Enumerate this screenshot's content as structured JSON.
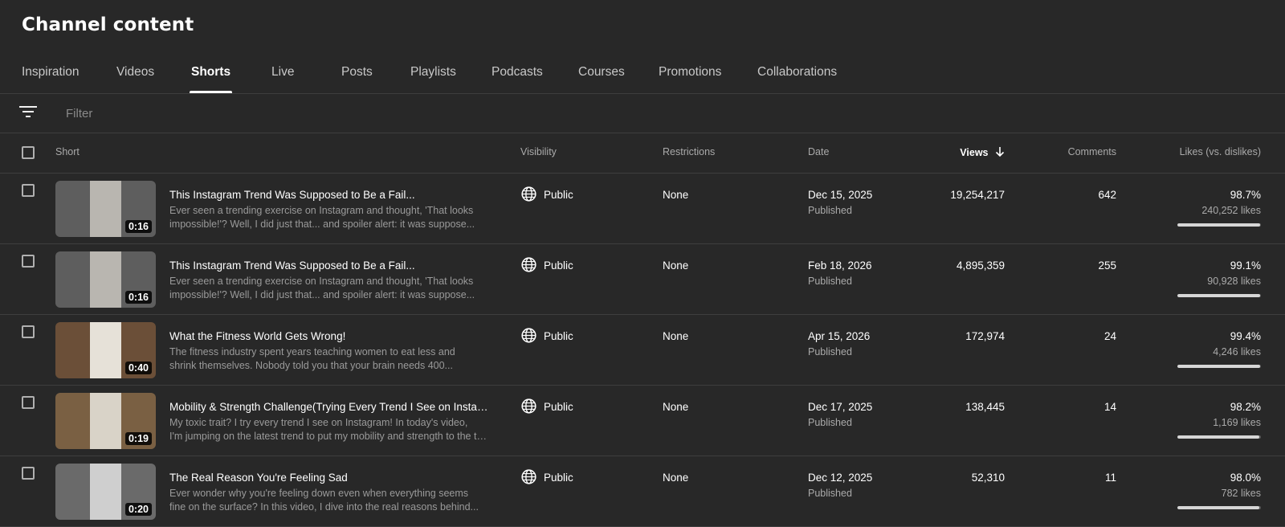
{
  "page": {
    "title": "Channel content"
  },
  "tabs": [
    {
      "label": "Inspiration",
      "active": false
    },
    {
      "label": "Videos",
      "active": false
    },
    {
      "label": "Shorts",
      "active": true
    },
    {
      "label": "Live",
      "active": false
    },
    {
      "label": "Posts",
      "active": false
    },
    {
      "label": "Playlists",
      "active": false
    },
    {
      "label": "Podcasts",
      "active": false
    },
    {
      "label": "Courses",
      "active": false
    },
    {
      "label": "Promotions",
      "active": false
    },
    {
      "label": "Collaborations",
      "active": false
    }
  ],
  "filter": {
    "placeholder": "Filter",
    "icon": "filter-icon"
  },
  "table": {
    "columns": {
      "short": "Short",
      "visibility": "Visibility",
      "restrictions": "Restrictions",
      "date": "Date",
      "views": "Views",
      "comments": "Comments",
      "likes": "Likes (vs. dislikes)"
    },
    "sort_icon": "arrow-down-icon",
    "rows": [
      {
        "duration": "0:16",
        "title": "This Instagram Trend Was Supposed to Be a Fail...",
        "desc1": "Ever seen a trending exercise on Instagram and thought, 'That looks",
        "desc2": "impossible!'? Well, I did just that... and spoiler alert: it was suppose...",
        "visibility": "Public",
        "restrictions": "None",
        "date": "Dec 15, 2025",
        "status": "Published",
        "views": "19,254,217",
        "comments": "642",
        "likes_pct": "98.7%",
        "likes_ratio": 0.987,
        "likes_count": "240,252 likes",
        "thumb_bg": "#5e5e5e",
        "thumb_accent": "#b9b6b0"
      },
      {
        "duration": "0:16",
        "title": "This Instagram Trend Was Supposed to Be a Fail...",
        "desc1": "Ever seen a trending exercise on Instagram and thought, 'That looks",
        "desc2": "impossible!'? Well, I did just that... and spoiler alert: it was suppose...",
        "visibility": "Public",
        "restrictions": "None",
        "date": "Feb 18, 2026",
        "status": "Published",
        "views": "4,895,359",
        "comments": "255",
        "likes_pct": "99.1%",
        "likes_ratio": 0.991,
        "likes_count": "90,928 likes",
        "thumb_bg": "#5e5e5e",
        "thumb_accent": "#b9b6b0"
      },
      {
        "duration": "0:40",
        "title": "What the Fitness World Gets Wrong!",
        "desc1": "The fitness industry spent years teaching women to eat less and",
        "desc2": "shrink themselves. Nobody told you that your brain needs 400...",
        "visibility": "Public",
        "restrictions": "None",
        "date": "Apr 15, 2026",
        "status": "Published",
        "views": "172,974",
        "comments": "24",
        "likes_pct": "99.4%",
        "likes_ratio": 0.994,
        "likes_count": "4,246 likes",
        "thumb_bg": "#6b4f38",
        "thumb_accent": "#e6e1d8"
      },
      {
        "duration": "0:19",
        "title": "Mobility & Strength Challenge(Trying Every Trend I See on Instagram)",
        "desc1": "My toxic trait? I try every trend I see on Instagram! In today's video,",
        "desc2": "I'm jumping on the latest trend to put my mobility and strength to the test",
        "visibility": "Public",
        "restrictions": "None",
        "date": "Dec 17, 2025",
        "status": "Published",
        "views": "138,445",
        "comments": "14",
        "likes_pct": "98.2%",
        "likes_ratio": 0.982,
        "likes_count": "1,169 likes",
        "thumb_bg": "#7a6043",
        "thumb_accent": "#d9d3c8"
      },
      {
        "duration": "0:20",
        "title": "The Real Reason You're Feeling Sad",
        "desc1": "Ever wonder why you're feeling down even when everything seems",
        "desc2": "fine on the surface? In this video, I dive into the real reasons behind...",
        "visibility": "Public",
        "restrictions": "None",
        "date": "Dec 12, 2025",
        "status": "Published",
        "views": "52,310",
        "comments": "11",
        "likes_pct": "98.0%",
        "likes_ratio": 0.98,
        "likes_count": "782 likes",
        "thumb_bg": "#6a6a6a",
        "thumb_accent": "#cfcfcf"
      }
    ]
  }
}
